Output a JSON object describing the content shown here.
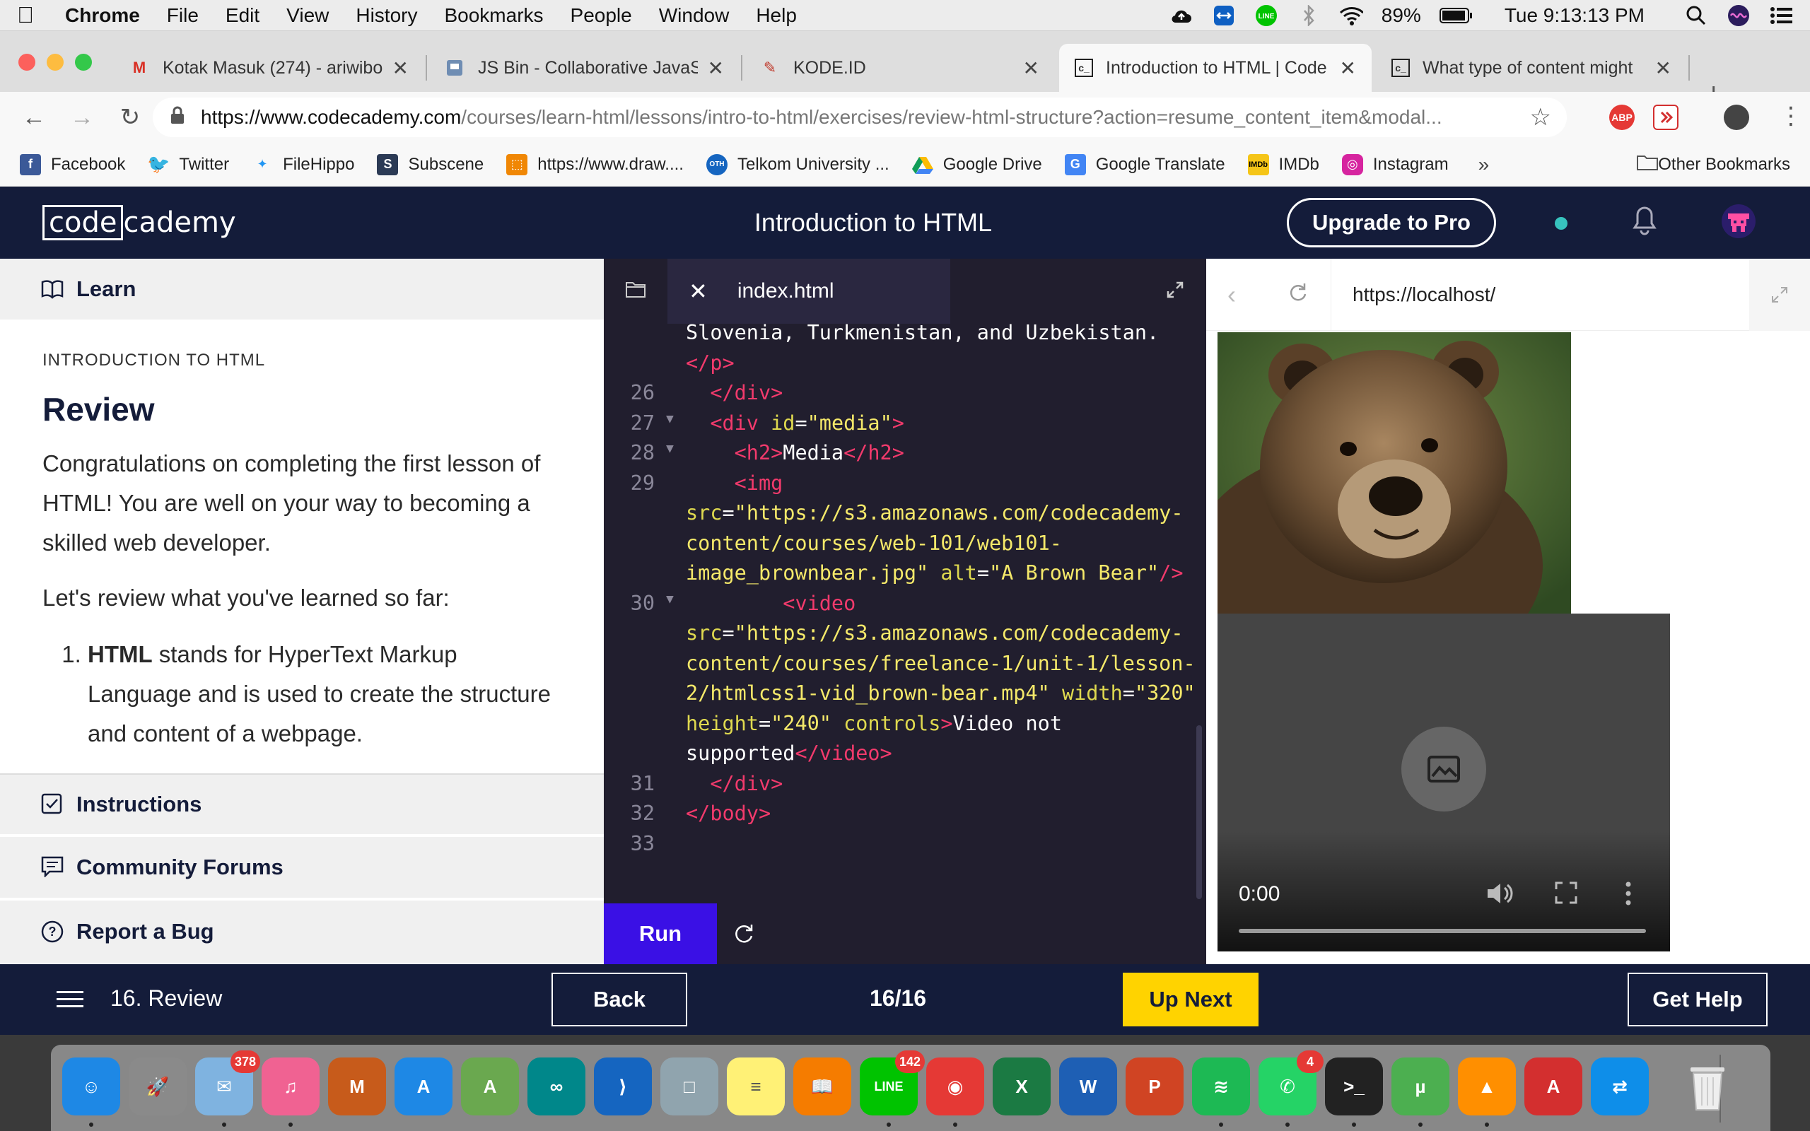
{
  "menubar": {
    "app": "Chrome",
    "items": [
      "File",
      "Edit",
      "View",
      "History",
      "Bookmarks",
      "People",
      "Window",
      "Help"
    ],
    "battery": "89%",
    "clock": "Tue 9:13:13 PM"
  },
  "tabs": [
    {
      "title": "Kotak Masuk (274) - ariwibo",
      "icon": "gmail-icon"
    },
    {
      "title": "JS Bin - Collaborative JavaS",
      "icon": "jsbin-icon"
    },
    {
      "title": "KODE.ID",
      "icon": "kode-icon"
    },
    {
      "title": "Introduction to HTML | Code",
      "icon": "codecademy-icon",
      "active": true
    },
    {
      "title": "What type of content might",
      "icon": "codecademy-icon"
    }
  ],
  "toolbar": {
    "url_host": "https://www.codecademy.com",
    "url_path": "/courses/learn-html/lessons/intro-to-html/exercises/review-html-structure?action=resume_content_item&modal...",
    "ext_abp": "ABP"
  },
  "bookmarks": {
    "items": [
      "Facebook",
      "Twitter",
      "FileHippo",
      "Subscene",
      "https://www.draw....",
      "Telkom University ...",
      "Google Drive",
      "Google Translate",
      "IMDb",
      "Instagram"
    ],
    "overflow": "»",
    "other": "Other Bookmarks"
  },
  "header": {
    "logo_box": "code",
    "logo_rest": "cademy",
    "title": "Introduction to HTML",
    "upgrade": "Upgrade to Pro"
  },
  "left": {
    "learn": "Learn",
    "kicker": "INTRODUCTION TO HTML",
    "heading": "Review",
    "p1": "Congratulations on completing the first lesson of HTML! You are well on your way to becoming a skilled web developer.",
    "p2": "Let's review what you've learned so far:",
    "li1_bold": "HTML",
    "li1_rest": " stands for HyperText Markup Language and is used to create the structure and content of a webpage.",
    "instructions": "Instructions",
    "forums": "Community Forums",
    "bug": "Report a Bug"
  },
  "editor": {
    "file": "index.html",
    "run": "Run",
    "lines": [
      {
        "n": "",
        "fold": false,
        "html": "Slovenia, Turkmenistan, and Uzbekistan."
      },
      {
        "n": "",
        "fold": false,
        "html": "<span class='tag'>&lt;/p&gt;</span>"
      },
      {
        "n": "26",
        "fold": false,
        "html": "  <span class='tag'>&lt;/div&gt;</span>"
      },
      {
        "n": "27",
        "fold": true,
        "html": "  <span class='tag'>&lt;div</span> <span class='attr'>id</span>=<span class='str'>\"media\"</span><span class='tag'>&gt;</span>"
      },
      {
        "n": "28",
        "fold": true,
        "html": "    <span class='tag'>&lt;h2&gt;</span>Media<span class='tag'>&lt;/h2&gt;</span>"
      },
      {
        "n": "29",
        "fold": false,
        "html": "    <span class='tag'>&lt;img</span>"
      },
      {
        "n": "",
        "fold": false,
        "html": "<span class='attr'>src</span>=<span class='str'>\"https://s3.amazonaws.com/codecademy-</span>"
      },
      {
        "n": "",
        "fold": false,
        "html": "<span class='str'>content/courses/web-101/web101-</span>"
      },
      {
        "n": "",
        "fold": false,
        "html": "<span class='str'>image_brownbear.jpg\"</span> <span class='attr'>alt</span>=<span class='str'>\"A Brown Bear\"</span><span class='tag'>/&gt;</span>"
      },
      {
        "n": "30",
        "fold": true,
        "html": "        <span class='tag'>&lt;video</span>"
      },
      {
        "n": "",
        "fold": false,
        "html": "<span class='attr'>src</span>=<span class='str'>\"https://s3.amazonaws.com/codecademy-</span>"
      },
      {
        "n": "",
        "fold": false,
        "html": "<span class='str'>content/courses/freelance-1/unit-1/lesson-</span>"
      },
      {
        "n": "",
        "fold": false,
        "html": "<span class='str'>2/htmlcss1-vid_brown-bear.mp4\"</span> <span class='attr'>width</span>=<span class='str'>\"320\"</span>"
      },
      {
        "n": "",
        "fold": false,
        "html": "<span class='attr'>height</span>=<span class='str'>\"240\"</span> <span class='attr'>controls</span><span class='tag'>&gt;</span>Video not"
      },
      {
        "n": "",
        "fold": false,
        "html": "supported<span class='tag'>&lt;/video&gt;</span>"
      },
      {
        "n": "31",
        "fold": false,
        "html": "  <span class='tag'>&lt;/div&gt;</span>"
      },
      {
        "n": "32",
        "fold": false,
        "html": "<span class='tag'>&lt;/body&gt;</span>"
      },
      {
        "n": "33",
        "fold": false,
        "html": ""
      }
    ]
  },
  "preview": {
    "url": "https://localhost/",
    "image_alt": "A Brown Bear",
    "video_time": "0:00"
  },
  "footer": {
    "lesson": "16. Review",
    "back": "Back",
    "progress": "16/16",
    "up_next": "Up Next",
    "get_help": "Get Help"
  },
  "dock": {
    "apps": [
      {
        "name": "finder",
        "color": "#1e88e5",
        "label": "☺"
      },
      {
        "name": "launchpad",
        "color": "#8a8a8a",
        "label": "🚀"
      },
      {
        "name": "mail",
        "color": "#7fb3e0",
        "label": "✉",
        "badge": "378"
      },
      {
        "name": "itunes",
        "color": "#f06292",
        "label": "♫"
      },
      {
        "name": "matlab",
        "color": "#c75b1b",
        "label": "M"
      },
      {
        "name": "app-store",
        "color": "#1e88e5",
        "label": "A"
      },
      {
        "name": "android-studio",
        "color": "#6aa84f",
        "label": "A"
      },
      {
        "name": "arduino",
        "color": "#00878a",
        "label": "∞"
      },
      {
        "name": "vscode",
        "color": "#1565c0",
        "label": "⟩"
      },
      {
        "name": "virtualbox",
        "color": "#90a4ae",
        "label": "□"
      },
      {
        "name": "notes",
        "color": "#fff176",
        "label": "≡"
      },
      {
        "name": "ibooks",
        "color": "#f57c00",
        "label": "📖"
      },
      {
        "name": "line",
        "color": "#00c300",
        "label": "LINE",
        "badge": "142"
      },
      {
        "name": "chrome",
        "color": "#e53935",
        "label": "◉"
      },
      {
        "name": "excel",
        "color": "#1b7a43",
        "label": "X"
      },
      {
        "name": "word",
        "color": "#1e5fb4",
        "label": "W"
      },
      {
        "name": "powerpoint",
        "color": "#d04423",
        "label": "P"
      },
      {
        "name": "spotify",
        "color": "#1db954",
        "label": "≋"
      },
      {
        "name": "whatsapp",
        "color": "#25d366",
        "label": "✆",
        "badge": "4"
      },
      {
        "name": "terminal",
        "color": "#222222",
        "label": ">_"
      },
      {
        "name": "utorrent",
        "color": "#4caf50",
        "label": "µ"
      },
      {
        "name": "vlc",
        "color": "#ff8f00",
        "label": "▲"
      },
      {
        "name": "acrobat",
        "color": "#d32f2f",
        "label": "A"
      },
      {
        "name": "teamviewer",
        "color": "#0e8ee9",
        "label": "⇄"
      }
    ],
    "trash": "trash"
  }
}
